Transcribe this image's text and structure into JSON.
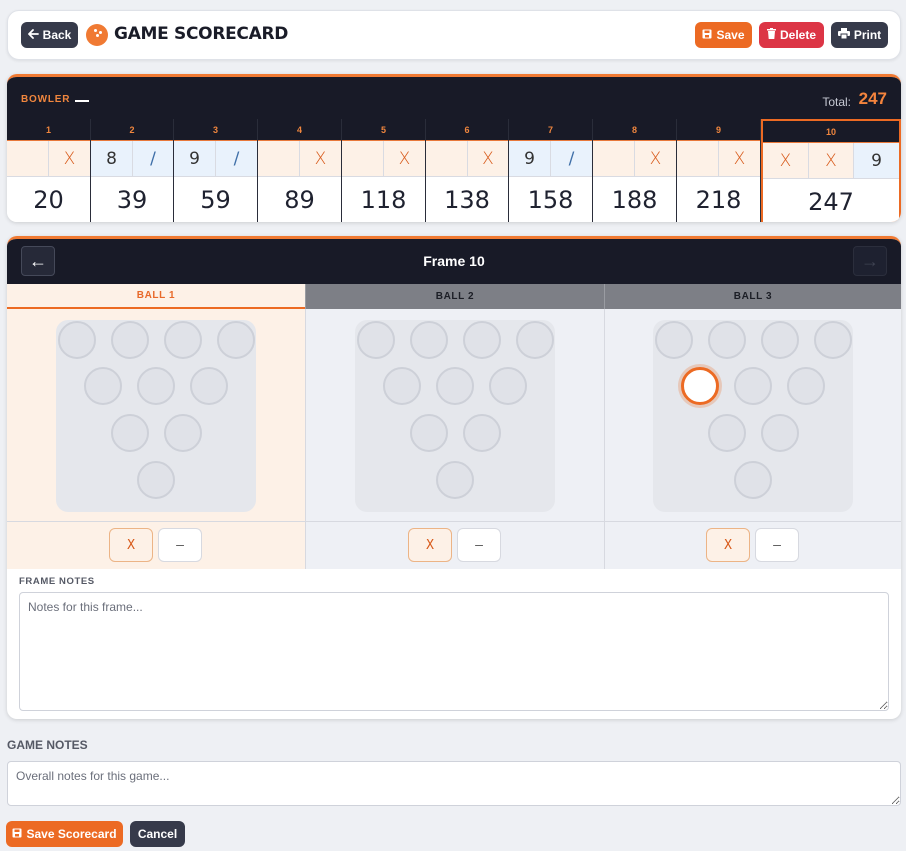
{
  "header": {
    "back_label": "Back",
    "title": "GAME SCORECARD",
    "save_label": "Save",
    "delete_label": "Delete",
    "print_label": "Print"
  },
  "scorecard": {
    "bowler_label": "BOWLER",
    "bowler_name": "—",
    "total_label": "Total:",
    "total_value": "247",
    "frames": [
      {
        "num": "1",
        "balls": [
          "",
          "X"
        ],
        "score": "20"
      },
      {
        "num": "2",
        "balls": [
          "8",
          "/"
        ],
        "score": "39"
      },
      {
        "num": "3",
        "balls": [
          "9",
          "/"
        ],
        "score": "59"
      },
      {
        "num": "4",
        "balls": [
          "",
          "X"
        ],
        "score": "89"
      },
      {
        "num": "5",
        "balls": [
          "",
          "X"
        ],
        "score": "118"
      },
      {
        "num": "6",
        "balls": [
          "",
          "X"
        ],
        "score": "138"
      },
      {
        "num": "7",
        "balls": [
          "9",
          "/"
        ],
        "score": "158"
      },
      {
        "num": "8",
        "balls": [
          "",
          "X"
        ],
        "score": "188"
      },
      {
        "num": "9",
        "balls": [
          "",
          "X"
        ],
        "score": "218"
      },
      {
        "num": "10",
        "balls": [
          "X",
          "X",
          "9"
        ],
        "score": "247"
      }
    ]
  },
  "frame_editor": {
    "title": "Frame 10",
    "prev_icon": "←",
    "next_icon": "→",
    "tabs": [
      "BALL 1",
      "BALL 2",
      "BALL 3"
    ],
    "active_tab": 0,
    "ball3_standing_pin": 5,
    "quick_buttons": {
      "strike": "X",
      "miss": "–"
    },
    "notes_label": "FRAME NOTES",
    "notes_placeholder": "Notes for this frame..."
  },
  "game_notes": {
    "label": "GAME NOTES",
    "placeholder": "Overall notes for this game..."
  },
  "footer": {
    "save_label": "Save Scorecard",
    "cancel_label": "Cancel"
  },
  "colors": {
    "accent": "#ec6a23",
    "dark": "#181a27",
    "danger": "#dc3545"
  }
}
